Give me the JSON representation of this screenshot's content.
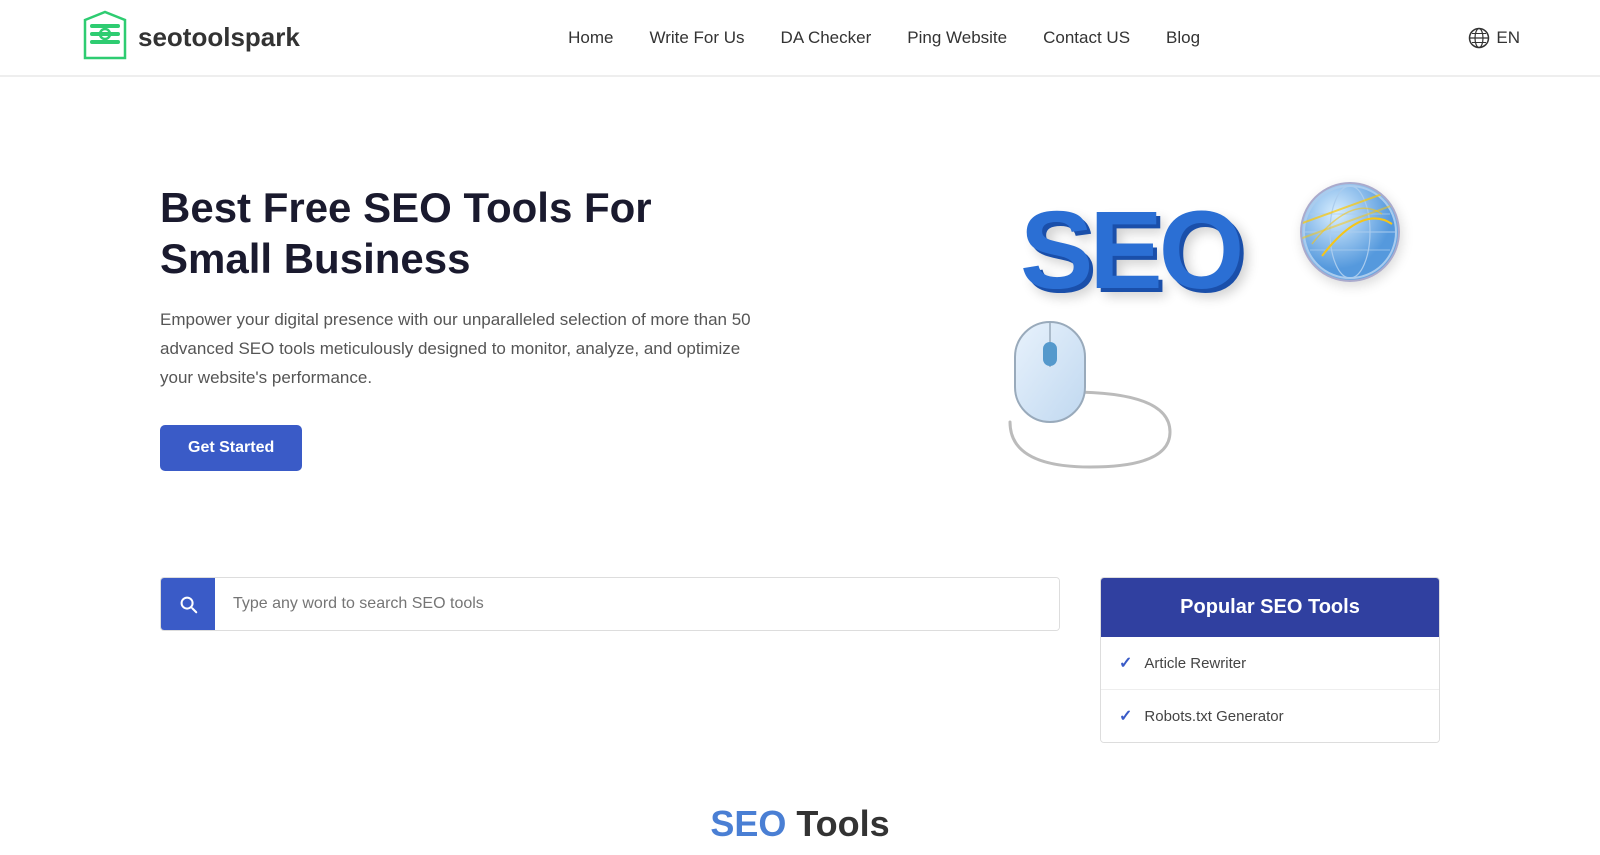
{
  "site": {
    "logo_text_main": "seotoolspark",
    "logo_text_prefix": ""
  },
  "navbar": {
    "links": [
      {
        "label": "Home",
        "href": "#"
      },
      {
        "label": "Write For Us",
        "href": "#"
      },
      {
        "label": "DA Checker",
        "href": "#"
      },
      {
        "label": "Ping Website",
        "href": "#"
      },
      {
        "label": "Contact US",
        "href": "#"
      },
      {
        "label": "Blog",
        "href": "#"
      }
    ],
    "lang": "EN"
  },
  "hero": {
    "title": "Best Free SEO Tools For Small Business",
    "description": "Empower your digital presence with our unparalleled selection of more than 50 advanced SEO tools meticulously designed to monitor, analyze, and optimize your website's performance.",
    "cta_label": "Get Started"
  },
  "search": {
    "placeholder": "Type any word to search SEO tools"
  },
  "popular_panel": {
    "heading": "Popular SEO Tools",
    "items": [
      {
        "label": "Article Rewriter"
      },
      {
        "label": "Robots.txt Generator"
      }
    ]
  },
  "tools_section": {
    "heading_colored": "SEO",
    "heading_plain": " Tools"
  },
  "icons": {
    "search": "search-icon",
    "globe": "globe-icon",
    "check": "check-icon"
  }
}
